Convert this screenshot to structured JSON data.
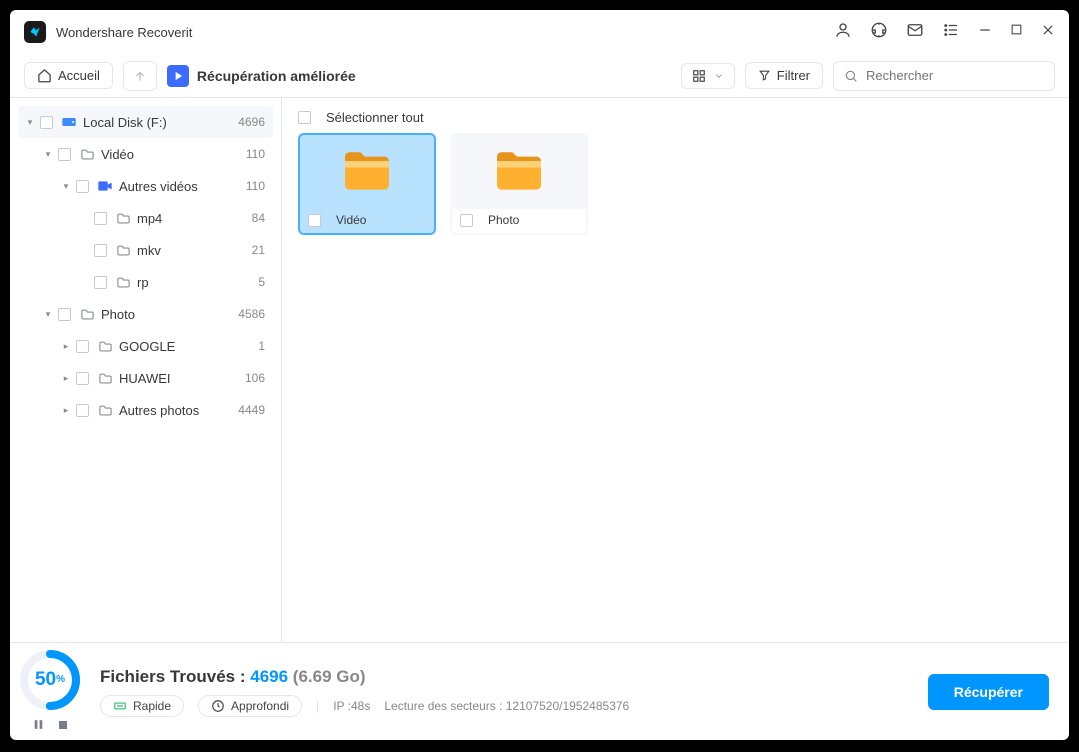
{
  "app": {
    "title": "Wondershare Recoverit"
  },
  "toolbar": {
    "home": "Accueil",
    "mode": "Récupération améliorée",
    "filter": "Filtrer",
    "search_placeholder": "Rechercher"
  },
  "tree": [
    {
      "indent": 0,
      "exp": "▾",
      "icon": "disk",
      "label": "Local Disk (F:)",
      "count": "4696",
      "selected": true
    },
    {
      "indent": 1,
      "exp": "▾",
      "icon": "folder",
      "label": "Vidéo",
      "count": "110"
    },
    {
      "indent": 2,
      "exp": "▾",
      "icon": "video",
      "label": "Autres vidéos",
      "count": "110"
    },
    {
      "indent": 3,
      "exp": "",
      "icon": "folder",
      "label": "mp4",
      "count": "84"
    },
    {
      "indent": 3,
      "exp": "",
      "icon": "folder",
      "label": "mkv",
      "count": "21"
    },
    {
      "indent": 3,
      "exp": "",
      "icon": "folder",
      "label": "rp",
      "count": "5"
    },
    {
      "indent": 1,
      "exp": "▾",
      "icon": "folder",
      "label": "Photo",
      "count": "4586"
    },
    {
      "indent": 2,
      "exp": "▸",
      "icon": "folder",
      "label": "GOOGLE",
      "count": "1"
    },
    {
      "indent": 2,
      "exp": "▸",
      "icon": "folder",
      "label": "HUAWEI",
      "count": "106"
    },
    {
      "indent": 2,
      "exp": "▸",
      "icon": "folder",
      "label": "Autres photos",
      "count": "4449"
    }
  ],
  "content": {
    "select_all": "Sélectionner tout",
    "items": [
      {
        "label": "Vidéo",
        "selected": true
      },
      {
        "label": "Photo",
        "selected": false
      }
    ]
  },
  "footer": {
    "progress_pct": "50",
    "progress_unit": "%",
    "found_label": "Fichiers Trouvés : ",
    "found_count": "4696",
    "found_size": "(6.69 Go)",
    "quick": "Rapide",
    "deep": "Approfondi",
    "ip": "IP :48s",
    "sectors_label": "Lecture des secteurs : ",
    "sectors": "12107520/1952485376",
    "recover": "Récupérer"
  }
}
